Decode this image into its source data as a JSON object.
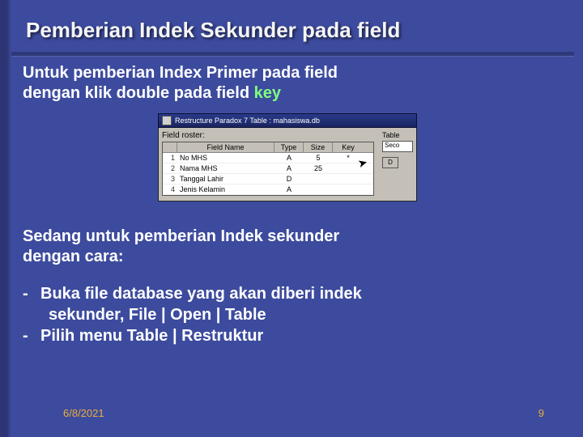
{
  "title": "Pemberian Indek Sekunder pada field",
  "para1_line1": "Untuk pemberian Index Primer pada field",
  "para1_line2_pre": "dengan klik double pada field ",
  "para1_key": "key",
  "screenshot": {
    "window_title": "Restructure Paradox 7 Table : mahasiswa.db",
    "section_label": "Field roster:",
    "right_label1": "Table",
    "right_val1": "Seco",
    "right_btn": "D",
    "headers": {
      "num": "",
      "name": "Field Name",
      "type": "Type",
      "size": "Size",
      "key": "Key"
    },
    "rows": [
      {
        "n": "1",
        "name": "No MHS",
        "type": "A",
        "size": "5",
        "key": "*"
      },
      {
        "n": "2",
        "name": "Nama MHS",
        "type": "A",
        "size": "25",
        "key": ""
      },
      {
        "n": "3",
        "name": "Tanggal Lahir",
        "type": "D",
        "size": "",
        "key": ""
      },
      {
        "n": "4",
        "name": "Jenis Kelamin",
        "type": "A",
        "size": "",
        "key": ""
      }
    ]
  },
  "para2_line1": "Sedang untuk pemberian Indek sekunder",
  "para2_line2": "dengan cara:",
  "bullet1_a": "Buka file database yang akan diberi indek",
  "bullet1_b": "sekunder, File | Open | Table",
  "bullet2": "Pilih menu Table | Restruktur",
  "footer": {
    "date": "6/8/2021",
    "page": "9"
  }
}
